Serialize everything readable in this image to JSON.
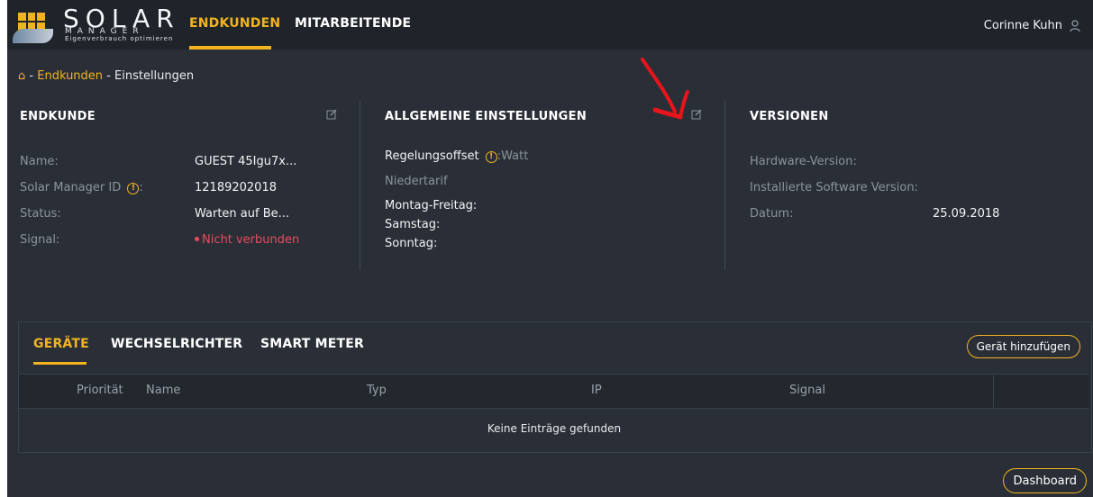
{
  "header": {
    "logo_title": "SOLAR",
    "logo_sub": "MANAGER",
    "logo_tagline": "Eigenverbrauch optimieren",
    "nav": [
      {
        "label": "ENDKUNDEN",
        "active": true
      },
      {
        "label": "MITARBEITENDE",
        "active": false
      }
    ],
    "user_name": "Corinne Kuhn",
    "icons": {
      "user": "user-icon",
      "home": "home-icon",
      "edit": "edit-icon",
      "info": "info-icon"
    }
  },
  "breadcrumb": {
    "sep1": " - ",
    "link": "Endkunden",
    "sep2": " - ",
    "current": "Einstellungen"
  },
  "endkunde": {
    "title": "ENDKUNDE",
    "rows": [
      {
        "label": "Name:",
        "value": "GUEST 45Igu7x..."
      },
      {
        "label": "Solar Manager ID",
        "label_suffix": ":",
        "value": "12189202018"
      },
      {
        "label": "Status:",
        "value": "Warten auf Be..."
      },
      {
        "label": "Signal:",
        "value": "Nicht verbunden"
      }
    ]
  },
  "allgemein": {
    "title": "ALLGEMEINE EINSTELLUNGEN",
    "regelungsoffset_label": "Regelungsoffset",
    "regelungsoffset_value": ":Watt",
    "niedertarif": "Niedertarif",
    "montag": "Montag-Freitag:",
    "samstag": "Samstag:",
    "sonntag": "Sonntag:"
  },
  "versionen": {
    "title": "VERSIONEN",
    "hardware": "Hardware-Version:",
    "software": "Installierte Software Version:",
    "datum_label": "Datum:",
    "datum_value": "25.09.2018"
  },
  "devices": {
    "tabs": [
      {
        "label": "GERÄTE",
        "active": true
      },
      {
        "label": "WECHSELRICHTER",
        "active": false
      },
      {
        "label": "SMART METER",
        "active": false
      }
    ],
    "add_button": "Gerät hinzufügen",
    "columns": [
      "Priorität",
      "Name",
      "Typ",
      "IP",
      "Signal"
    ],
    "empty_message": "Keine Einträge gefunden"
  },
  "footer": {
    "dashboard_button": "Dashboard"
  },
  "colors": {
    "accent": "#f3b321",
    "error": "#e74c5e",
    "annotation": "#e8141c",
    "background": "#2a2f37",
    "topbar": "#1f242b"
  }
}
